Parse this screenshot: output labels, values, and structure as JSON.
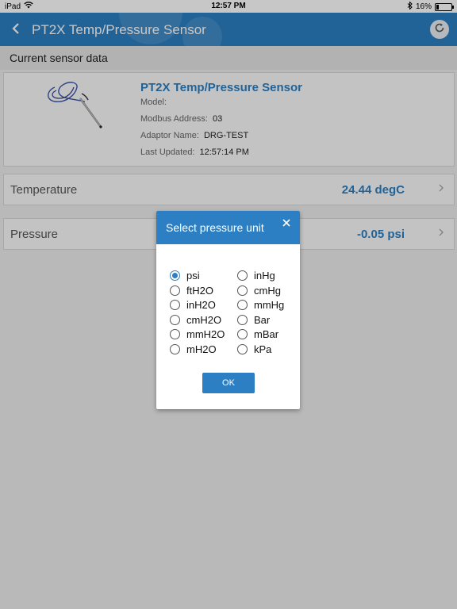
{
  "status_bar": {
    "device": "iPad",
    "time": "12:57 PM",
    "battery": "16%",
    "battery_level": 0.16,
    "icons": [
      "wifi-icon",
      "bluetooth-icon",
      "battery-icon"
    ]
  },
  "navbar": {
    "title": "PT2X Temp/Pressure Sensor",
    "back_icon": "chevron-left-icon",
    "refresh_icon": "refresh-icon",
    "accent_color": "#2c7fc2"
  },
  "section": {
    "label": "Current sensor data"
  },
  "sensor": {
    "name": "PT2X Temp/Pressure Sensor",
    "model_label": "Model:",
    "model_value": "",
    "modbus_label": "Modbus Address:",
    "modbus_value": "03",
    "adaptor_label": "Adaptor Name:",
    "adaptor_value": "DRG-TEST",
    "updated_label": "Last Updated:",
    "updated_value": "12:57:14 PM"
  },
  "readings": [
    {
      "label": "Temperature",
      "value": "24.44 degC"
    },
    {
      "label": "Pressure",
      "value": "-0.05 psi"
    }
  ],
  "dialog": {
    "title": "Select pressure unit",
    "ok_label": "OK",
    "selected": "psi",
    "units_left": [
      "psi",
      "ftH2O",
      "inH2O",
      "cmH2O",
      "mmH2O",
      "mH2O"
    ],
    "units_right": [
      "inHg",
      "cmHg",
      "mmHg",
      "Bar",
      "mBar",
      "kPa"
    ]
  }
}
